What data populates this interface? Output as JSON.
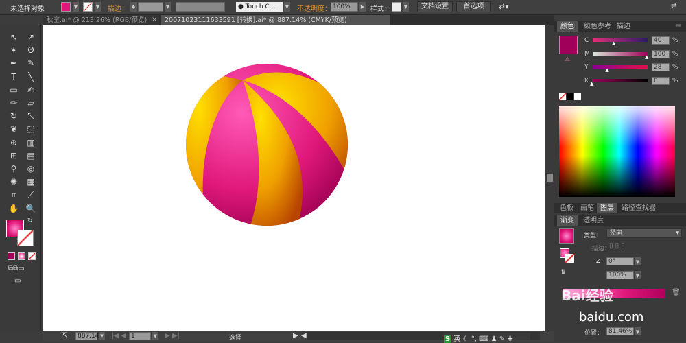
{
  "control_bar": {
    "selection": "未选择对象",
    "stroke_label": "描边：",
    "brush": "Touch C...",
    "opacity_label": "不透明度：",
    "opacity": "100%",
    "style_label": "样式：",
    "doc_setup": "文档设置",
    "preferences": "首选项"
  },
  "tabs": [
    {
      "label": "秋空.ai* @ 213.26% (RGB/预览)",
      "active": false
    },
    {
      "label": "20071023111633591 [转换].ai* @ 887.14% (CMYK/预览)",
      "active": true
    }
  ],
  "colors": {
    "accent": "#a0005a",
    "fill": "#e0187a",
    "pink": "#e8187f",
    "yellow": "#f5c000"
  },
  "color_panel": {
    "tabs": [
      "颜色",
      "颜色参考",
      "描边"
    ],
    "channels": [
      {
        "name": "C",
        "value": "40"
      },
      {
        "name": "M",
        "value": "100"
      },
      {
        "name": "Y",
        "value": "28"
      },
      {
        "name": "K",
        "value": "0"
      }
    ],
    "unit": "%"
  },
  "lower_tabs": [
    "色板",
    "画笔",
    "图层",
    "路径查找器"
  ],
  "gradient_panel": {
    "tabs": [
      "渐变",
      "透明度"
    ],
    "type_label": "类型：",
    "type": "径向",
    "stroke_label": "描边：",
    "angle": "0°",
    "aspect": "100%",
    "position_label": "位置：",
    "position": "81.46%"
  },
  "status": {
    "zoom": "887.14",
    "page": "1",
    "tool": "选择"
  },
  "watermark": {
    "text1": "Bai经验",
    "text2": "baidu.com"
  },
  "ime": {
    "label": "英"
  }
}
